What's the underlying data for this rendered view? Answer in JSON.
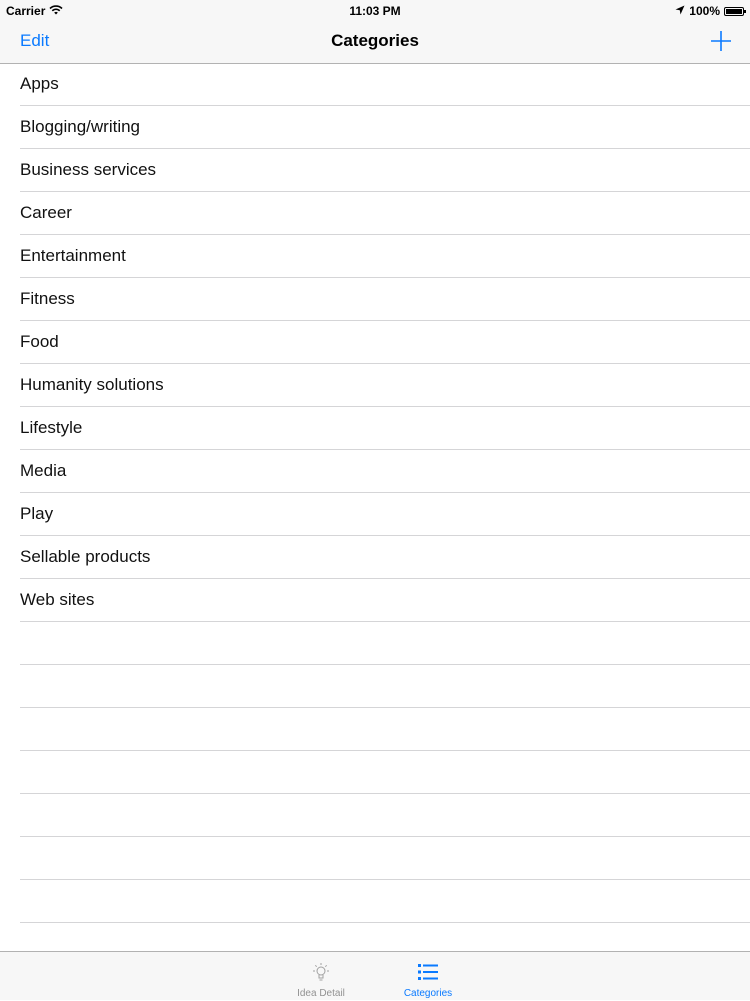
{
  "status_bar": {
    "carrier": "Carrier",
    "time": "11:03 PM",
    "battery": "100%"
  },
  "nav": {
    "edit_label": "Edit",
    "title": "Categories",
    "add_icon": "plus-icon"
  },
  "categories": [
    "Apps",
    "Blogging/writing",
    "Business services",
    "Career",
    "Entertainment",
    "Fitness",
    "Food",
    "Humanity solutions",
    "Lifestyle",
    "Media",
    "Play",
    "Sellable products",
    "Web sites"
  ],
  "tabs": [
    {
      "label": "Idea Detail",
      "icon": "lightbulb-icon",
      "selected": false
    },
    {
      "label": "Categories",
      "icon": "list-icon",
      "selected": true
    }
  ],
  "colors": {
    "accent": "#0a7aff",
    "inactive_tab": "#929292",
    "separator": "#d5d5d7",
    "bar_background": "#f7f7f7"
  }
}
